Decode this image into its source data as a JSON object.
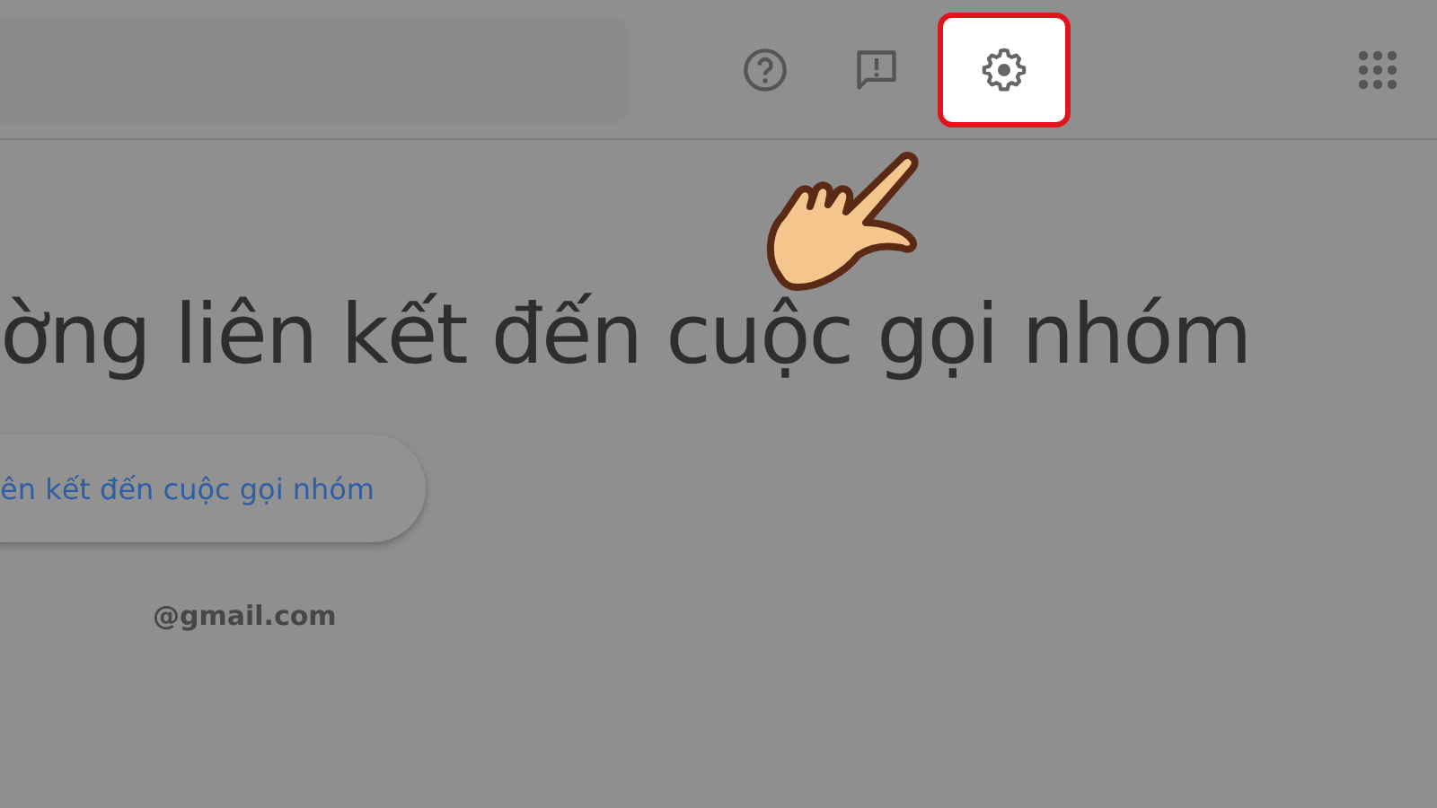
{
  "toolbar": {
    "buttons": [
      {
        "kind": "help",
        "highlighted": false
      },
      {
        "kind": "feedback",
        "highlighted": false
      },
      {
        "kind": "settings",
        "highlighted": true
      }
    ]
  },
  "main": {
    "heading": "ờng liên kết đến cuộc gọi nhóm",
    "link_button": "ên kết đến cuộc gọi nhóm",
    "account": "@gmail.com"
  }
}
